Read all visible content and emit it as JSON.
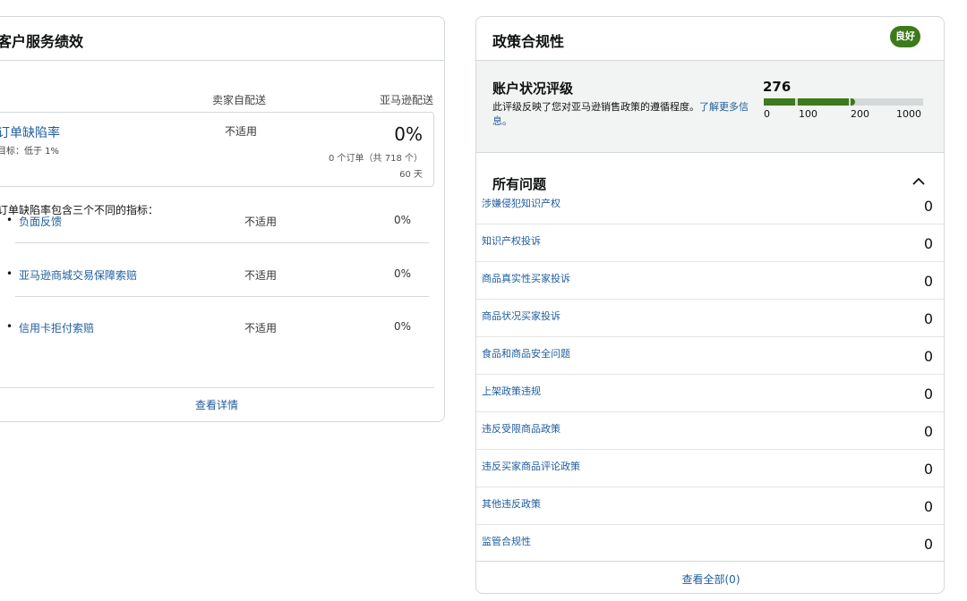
{
  "customer_service": {
    "title": "客户服务绩效",
    "col_seller": "卖家自配送",
    "col_amazon": "亚马逊配送",
    "odr": {
      "title": "订单缺陷率",
      "target": "目标：低于 1%",
      "seller_value": "不适用",
      "amazon_value": "0%",
      "orders_text": "0 个订单（共 718 个）",
      "days_text": "60 天"
    },
    "desc": "订单缺陷率包含三个不同的指标：",
    "metrics": [
      {
        "label": "负面反馈",
        "seller": "不适用",
        "amazon": "0%"
      },
      {
        "label": "亚马逊商城交易保障索赔",
        "seller": "不适用",
        "amazon": "0%"
      },
      {
        "label": "信用卡拒付索赔",
        "seller": "不适用",
        "amazon": "0%"
      }
    ],
    "view_details": "查看详情"
  },
  "policy": {
    "title": "政策合规性",
    "badge": "良好",
    "status_title": "账户状况评级",
    "status_desc": "此评级反映了您对亚马逊销售政策的遵循程度。",
    "status_link": "了解更多信息。",
    "score": "276",
    "scale_ticks": [
      "0",
      "100",
      "200",
      "1000"
    ],
    "colors": {
      "good": "#3c7a1b",
      "track": "#d5d9d9"
    },
    "issues_title": "所有问题",
    "issues": [
      {
        "label": "涉嫌侵犯知识产权",
        "count": "0"
      },
      {
        "label": "知识产权投诉",
        "count": "0"
      },
      {
        "label": "商品真实性买家投诉",
        "count": "0"
      },
      {
        "label": "商品状况买家投诉",
        "count": "0"
      },
      {
        "label": "食品和商品安全问题",
        "count": "0"
      },
      {
        "label": "上架政策违规",
        "count": "0"
      },
      {
        "label": "违反受限商品政策",
        "count": "0"
      },
      {
        "label": "违反买家商品评论政策",
        "count": "0"
      },
      {
        "label": "其他违反政策",
        "count": "0"
      },
      {
        "label": "监管合规性",
        "count": "0"
      }
    ],
    "view_all": "查看全部(0)"
  }
}
